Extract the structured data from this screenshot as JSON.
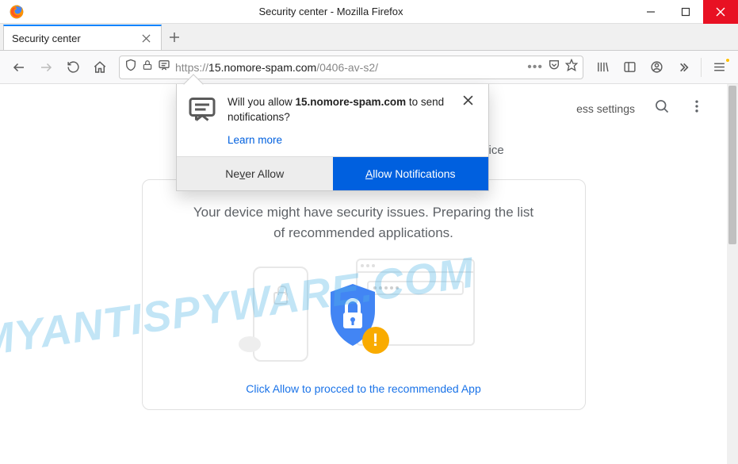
{
  "window": {
    "title": "Security center - Mozilla Firefox"
  },
  "tab": {
    "title": "Security center"
  },
  "url": {
    "protocol": "https://",
    "domain": "15.nomore-spam.com",
    "path": "/0406-av-s2/"
  },
  "notification": {
    "prompt_prefix": "Will you allow ",
    "prompt_domain": "15.nomore-spam.com",
    "prompt_suffix": " to send notifications?",
    "learn_more": "Learn more",
    "never_btn_pre": "Ne",
    "never_btn_u": "v",
    "never_btn_post": "er Allow",
    "allow_btn_u": "A",
    "allow_btn_post": "llow Notifications"
  },
  "page": {
    "header_link": "ess settings",
    "subtitle": "Settings and recommendations to protect your device",
    "card_title": "Your device might have security issues. Preparing the list of recommended applications.",
    "card_link": "Click Allow to procced to the recommended App",
    "warn_symbol": "!"
  },
  "watermark": "MYANTISPYWARE.COM"
}
